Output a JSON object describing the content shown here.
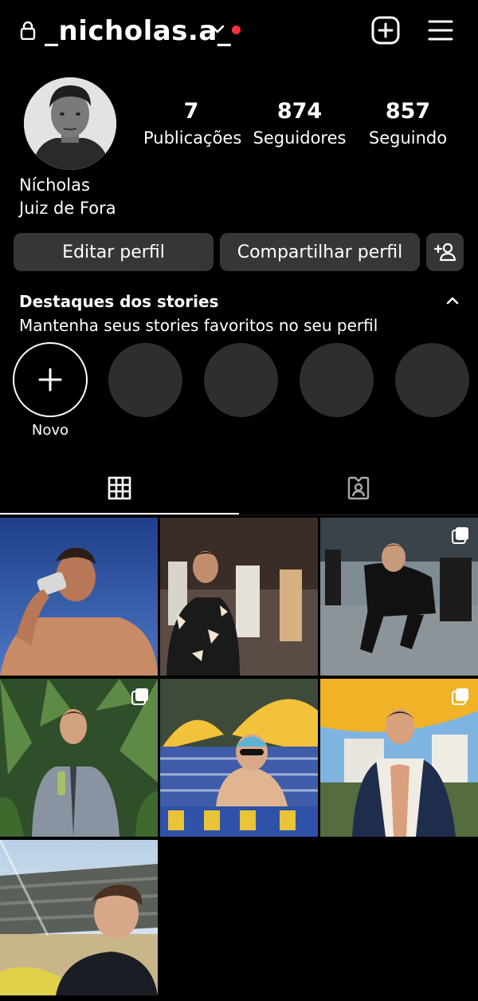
{
  "header": {
    "username": "_nicholas.a_"
  },
  "profile": {
    "stats": [
      {
        "count": "7",
        "label": "Publicações"
      },
      {
        "count": "874",
        "label": "Seguidores"
      },
      {
        "count": "857",
        "label": "Seguindo"
      }
    ],
    "name": "Nícholas",
    "bio": "Juiz de Fora"
  },
  "buttons": {
    "edit": "Editar perfil",
    "share": "Compartilhar perfil"
  },
  "highlights": {
    "title": "Destaques dos stories",
    "subtitle": "Mantenha seus stories favoritos no seu perfil",
    "new_label": "Novo"
  },
  "tabs": [
    {
      "icon": "grid-icon",
      "active": true
    },
    {
      "icon": "tagged-icon",
      "active": false
    }
  ],
  "posts": [
    {
      "multiple": false
    },
    {
      "multiple": false
    },
    {
      "multiple": true
    },
    {
      "multiple": true
    },
    {
      "multiple": false
    },
    {
      "multiple": true
    },
    {
      "multiple": false
    }
  ],
  "colors": {
    "background": "#000000",
    "button": "#363636",
    "notification": "#ff3040",
    "highlight_placeholder": "#2e2e2e"
  }
}
